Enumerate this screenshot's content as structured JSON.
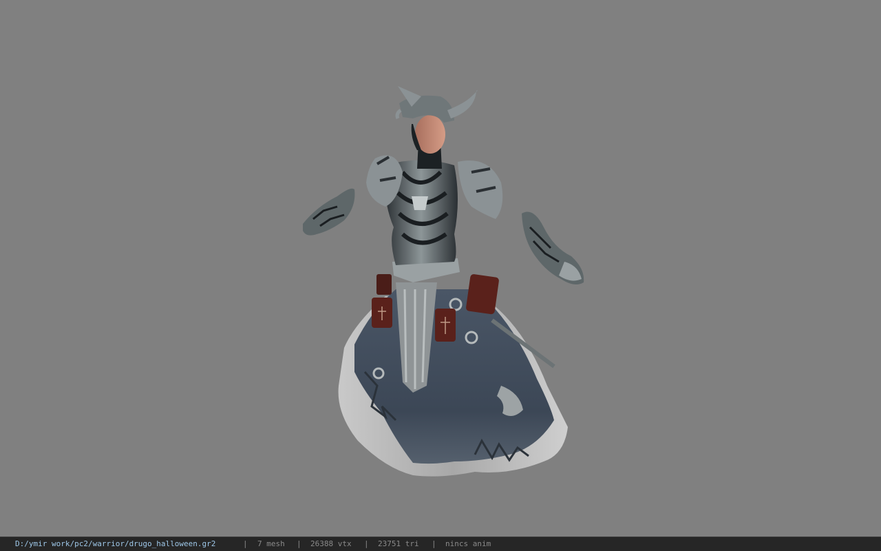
{
  "status_bar": {
    "file_path": "D:/ymir work/pc2/warrior/drugo_halloween.gr2",
    "separator": "|",
    "mesh_count": "7 mesh",
    "vertex_count": "26388 vtx",
    "triangle_count": "23751 tri",
    "animation": "nincs anim"
  },
  "colors": {
    "viewport_background": "#808080",
    "status_bar_background": "#262626",
    "path_text": "#9ec7e8",
    "info_text": "#8a8a8a"
  }
}
